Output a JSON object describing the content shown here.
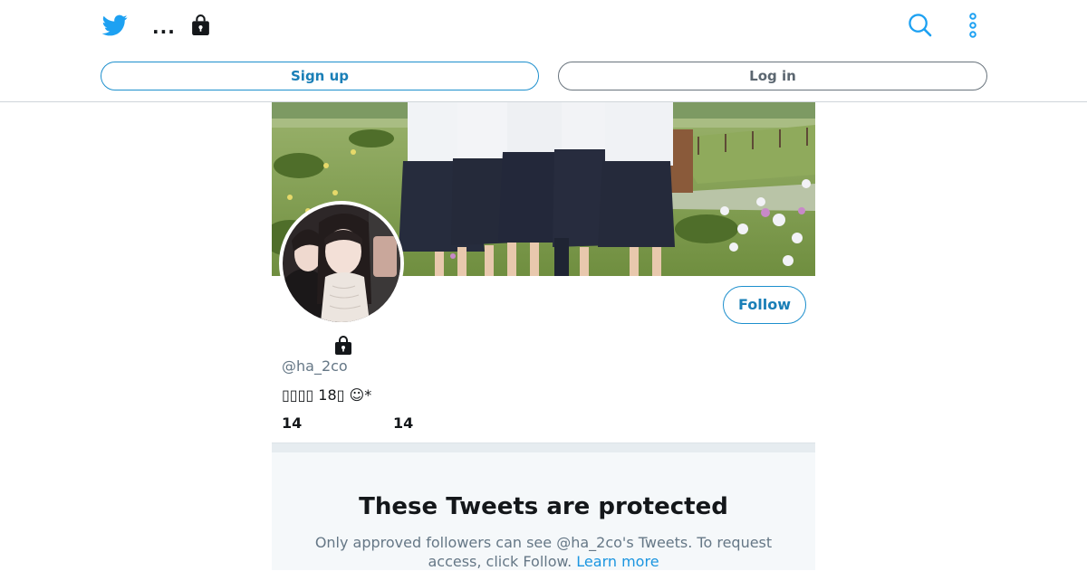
{
  "header": {
    "more_label": "...",
    "signup_label": "Sign up",
    "login_label": "Log in"
  },
  "icons": {
    "logo": "twitter-bird-icon",
    "more": "more-dots-icon",
    "bag": "lock-bag-icon",
    "search": "search-icon",
    "menu": "vertical-dots-icon"
  },
  "colors": {
    "brand": "#1da1f2",
    "link": "#1b95e0",
    "muted": "#657786"
  },
  "profile": {
    "handle": "@ha_2co",
    "bio": "▯▯▯▯ 18▯ ☺*",
    "stats": [
      "14",
      "14"
    ],
    "follow_label": "Follow"
  },
  "protected": {
    "title": "These Tweets are protected",
    "message": "Only approved followers can see @ha_2co's Tweets. To request access, click Follow. ",
    "link": "Learn more"
  }
}
